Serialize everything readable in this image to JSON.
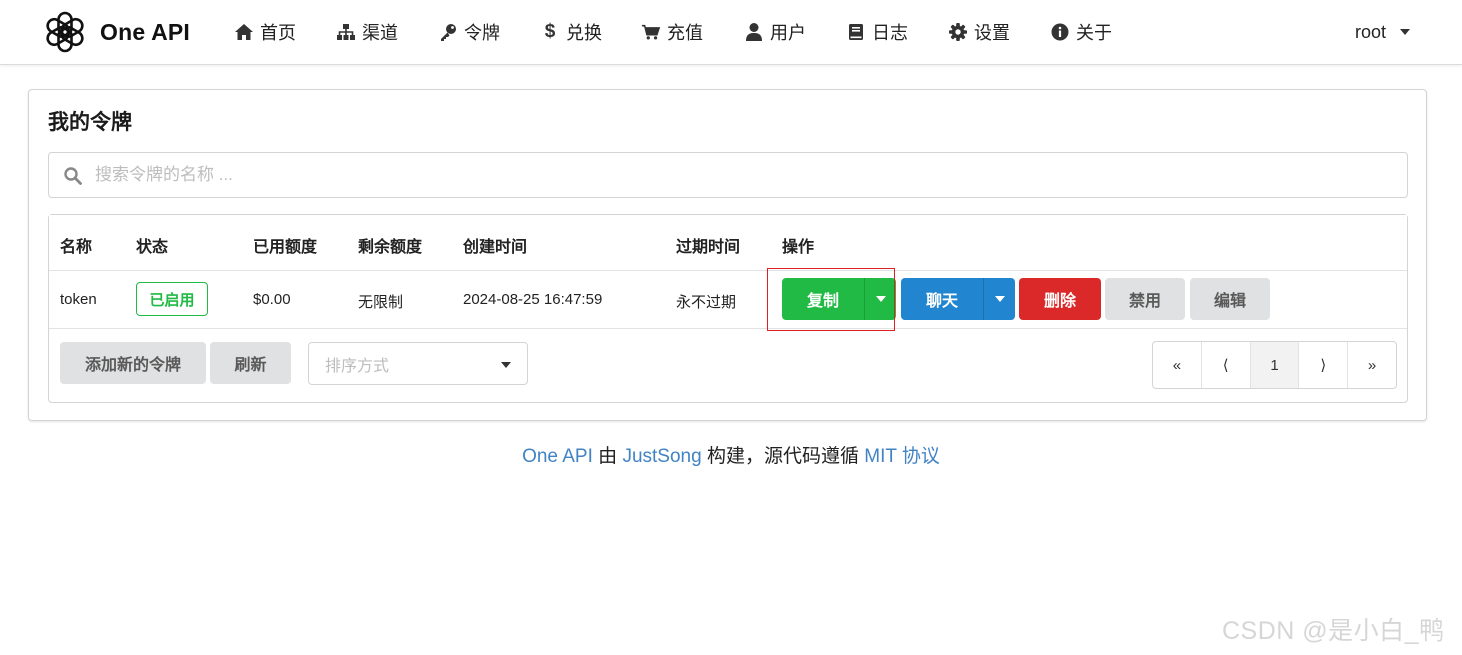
{
  "brand": {
    "name": "One API"
  },
  "nav": [
    {
      "label": "首页",
      "icon": "home-icon"
    },
    {
      "label": "渠道",
      "icon": "sitemap-icon"
    },
    {
      "label": "令牌",
      "icon": "key-icon"
    },
    {
      "label": "兑换",
      "icon": "dollar-icon"
    },
    {
      "label": "充值",
      "icon": "cart-icon"
    },
    {
      "label": "用户",
      "icon": "user-icon"
    },
    {
      "label": "日志",
      "icon": "book-icon"
    },
    {
      "label": "设置",
      "icon": "gear-icon"
    },
    {
      "label": "关于",
      "icon": "info-icon"
    }
  ],
  "user_menu": {
    "name": "root"
  },
  "page": {
    "title": "我的令牌"
  },
  "search": {
    "placeholder": "搜索令牌的名称 ..."
  },
  "table": {
    "headers": [
      "名称",
      "状态",
      "已用额度",
      "剩余额度",
      "创建时间",
      "过期时间",
      "操作"
    ],
    "rows": [
      {
        "name": "token",
        "status": "已启用",
        "used": "$0.00",
        "remaining": "无限制",
        "created": "2024-08-25 16:47:59",
        "expires": "永不过期",
        "actions": {
          "copy": "复制",
          "chat": "聊天",
          "delete": "删除",
          "disable": "禁用",
          "edit": "编辑"
        }
      }
    ]
  },
  "toolbar": {
    "add_label": "添加新的令牌",
    "refresh_label": "刷新",
    "sort_placeholder": "排序方式"
  },
  "pagination": {
    "first": "«",
    "prev": "⟨",
    "current": "1",
    "next": "⟩",
    "last": "»"
  },
  "footer": {
    "project": "One API",
    "by": "由",
    "author": "JustSong",
    "middle": "构建，源代码遵循",
    "license": "MIT 协议"
  },
  "watermark": "CSDN @是小白_鸭",
  "colors": {
    "green": "#21ba45",
    "blue": "#2185d0",
    "red": "#db2828",
    "grey": "#e0e1e2",
    "link": "#4183c4",
    "highlight": "#e02020"
  }
}
